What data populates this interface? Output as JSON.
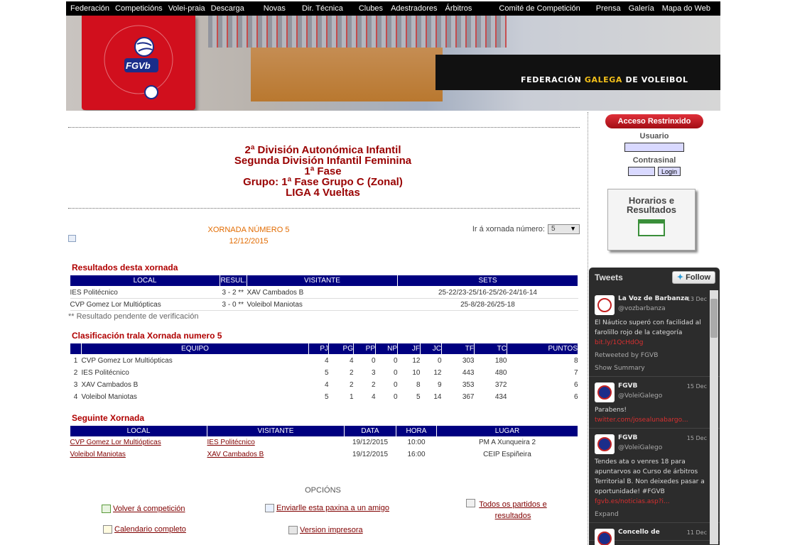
{
  "nav": [
    "Federación",
    "Competicións",
    "Volei-praia",
    "Descarga",
    "Novas",
    "Dir. Técnica",
    "Clubes",
    "Adestradores",
    "Árbitros",
    "Comité de Competición",
    "Prensa",
    "Galería",
    "Mapa do Web"
  ],
  "banner": {
    "logo_text": "Federación Galega de Voleibol",
    "logo_abbr": "FGVb",
    "title_pre": "FEDERACIÓN",
    "title_mid": "GALEGA",
    "title_post": "DE VOLEIBOL"
  },
  "heading": [
    "2ª División Autonómica Infantil",
    "Segunda División Infantil Feminina",
    "1ª Fase",
    "Grupo: 1ª Fase Grupo C (Zonal)",
    "LIGA 4 Vueltas"
  ],
  "xornada": {
    "title": "XORNADA NÚMERO 5",
    "date": "12/12/2015",
    "jump_label": "Ir á xornada número:",
    "jump_value": "5"
  },
  "results": {
    "title": "Resultados desta xornada",
    "headers": [
      "LOCAL",
      "RESUL.",
      "VISITANTE",
      "SETS"
    ],
    "rows": [
      {
        "local": "IES Politécnico",
        "result": "3 - 2 **",
        "visitor": "XAV Cambados B",
        "sets": "25-22/23-25/16-25/26-24/16-14"
      },
      {
        "local": "CVP Gomez Lor Multiópticas",
        "result": "3 - 0 **",
        "visitor": "Voleibol Maniotas",
        "sets": "25-8/28-26/25-18"
      }
    ],
    "note": "** Resultado pendente de verificación"
  },
  "standings": {
    "title": "Clasificación trala Xornada numero 5",
    "headers": [
      "",
      "EQUIPO",
      "PJ",
      "PG",
      "PP",
      "NP",
      "JF",
      "JC",
      "TF",
      "TC",
      "PUNTOS"
    ],
    "rows": [
      [
        "1",
        "CVP Gomez Lor Multiópticas",
        "4",
        "4",
        "0",
        "0",
        "12",
        "0",
        "303",
        "180",
        "8"
      ],
      [
        "2",
        "IES Politécnico",
        "5",
        "2",
        "3",
        "0",
        "10",
        "12",
        "443",
        "480",
        "7"
      ],
      [
        "3",
        "XAV Cambados B",
        "4",
        "2",
        "2",
        "0",
        "8",
        "9",
        "353",
        "372",
        "6"
      ],
      [
        "4",
        "Voleibol Maniotas",
        "5",
        "1",
        "4",
        "0",
        "5",
        "14",
        "367",
        "434",
        "6"
      ]
    ]
  },
  "next": {
    "title": "Seguinte Xornada",
    "headers": [
      "LOCAL",
      "VISITANTE",
      "DATA",
      "HORA",
      "LUGAR"
    ],
    "rows": [
      {
        "local": "CVP Gomez Lor Multiópticas",
        "visitor": "IES Politécnico",
        "date": "19/12/2015",
        "time": "10:00",
        "place": "PM A Xunqueira 2"
      },
      {
        "local": "Voleibol Maniotas",
        "visitor": "XAV Cambados B",
        "date": "19/12/2015",
        "time": "16:00",
        "place": "CEIP Espiñeira"
      }
    ]
  },
  "options": {
    "title": "OPCIÓNS",
    "back": "Volver á competición",
    "send": "Enviarlle esta paxina a un amigo",
    "all": "Todos os partidos e resultados",
    "calendar": "Calendario completo",
    "print": "Version impresora"
  },
  "login": {
    "header": "Acceso Restrinxido",
    "user_label": "Usuario",
    "pass_label": "Contrasinal",
    "button": "Login"
  },
  "horarios": "Horarios e Resultados",
  "twitter": {
    "title": "Tweets",
    "follow": "Follow",
    "tweets": [
      {
        "name": "La Voz de Barbanza",
        "handle": "@vozbarbanza",
        "date": "13 Dec",
        "text": "El Náutico superó con facilidad al farolillo rojo de la categoría",
        "link": "bit.ly/1QcHdOg",
        "meta": [
          "Retweeted by FGVB",
          "Show Summary"
        ]
      },
      {
        "name": "FGVB",
        "handle": "@VoleiGalego",
        "date": "15 Dec",
        "text": "Parabens!",
        "link": "twitter.com/josealunabargo...",
        "meta": []
      },
      {
        "name": "FGVB",
        "handle": "@VoleiGalego",
        "date": "15 Dec",
        "text": "Tendes ata o venres 18 para apuntarvos ao Curso de árbitros Territorial B. Non deixedes pasar a oportunidade! #FGVB",
        "link": "fgvb.es/noticias.asp?i...",
        "meta": [
          "Expand"
        ]
      },
      {
        "name": "Concello de",
        "handle": "",
        "date": "11 Dec",
        "text": "",
        "link": "",
        "meta": []
      }
    ]
  }
}
